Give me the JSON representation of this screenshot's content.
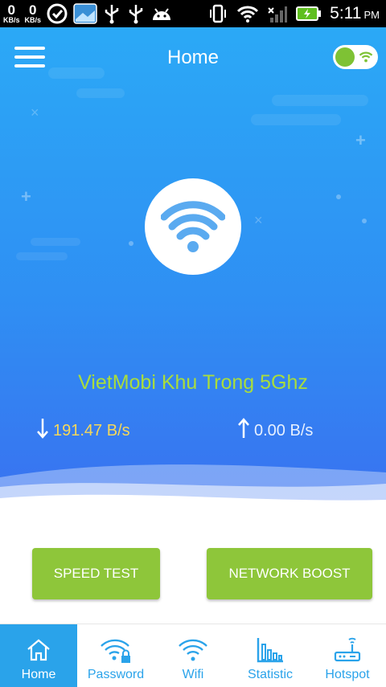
{
  "status_bar": {
    "down_speed": "0",
    "down_unit": "KB/s",
    "up_speed": "0",
    "up_unit": "KB/s",
    "time": "5:11",
    "ampm": "PM",
    "icons": [
      "timer-icon",
      "photo-icon",
      "usb-icon",
      "usb-icon",
      "android-icon",
      "vibrate-icon",
      "wifi-signal-icon",
      "cell-signal-icon",
      "battery-charging-icon"
    ]
  },
  "header": {
    "title": "Home",
    "menu_icon": "hamburger-menu-icon",
    "toggle_state": "on"
  },
  "hero": {
    "center_icon": "wifi-icon",
    "network_name": "VietMobi Khu Trong 5Ghz",
    "download_rate": "191.47 B/s",
    "upload_rate": "0.00 B/s"
  },
  "actions": {
    "speed_test_label": "SPEED TEST",
    "network_boost_label": "NETWORK BOOST"
  },
  "bottom_nav": {
    "items": [
      {
        "label": "Home",
        "icon": "home-icon",
        "active": true
      },
      {
        "label": "Password",
        "icon": "wifi-lock-icon",
        "active": false
      },
      {
        "label": "Wifi",
        "icon": "wifi-icon",
        "active": false
      },
      {
        "label": "Statistic",
        "icon": "bar-chart-icon",
        "active": false
      },
      {
        "label": "Hotspot",
        "icon": "router-icon",
        "active": false
      }
    ]
  },
  "colors": {
    "hero_top": "#2ba9f6",
    "hero_bottom": "#3a6ff0",
    "accent_green": "#8ec63a",
    "network_name": "#a9dd3c",
    "download_rate": "#f5d85a",
    "nav_active": "#2aa3ea"
  }
}
